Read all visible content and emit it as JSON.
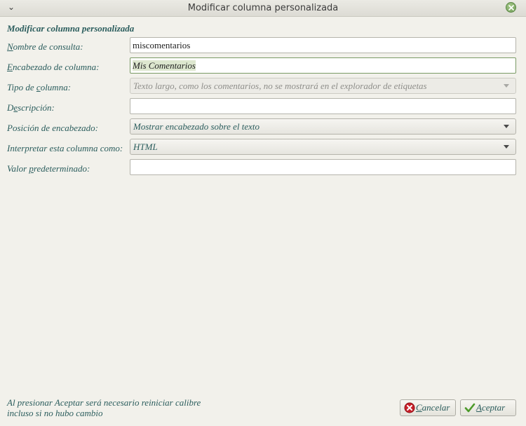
{
  "window": {
    "title": "Modificar columna personalizada",
    "menu_glyph": "⌄",
    "close_icon": "close-icon"
  },
  "form": {
    "section_title": "Modificar columna personalizada",
    "lookup_name": {
      "label_mnemonic": "N",
      "label_rest": "ombre de consulta:",
      "value": "miscomentarios"
    },
    "column_heading": {
      "label_mnemonic": "E",
      "label_rest": "ncabezado de columna:",
      "value": "Mis Comentarios"
    },
    "column_type": {
      "label_pre": "Tipo de ",
      "label_mnemonic": "c",
      "label_rest": "olumna:",
      "value": "Texto largo, como los comentarios, no se mostrará en el explorador de etiquetas",
      "disabled": true
    },
    "description": {
      "label_pre": "D",
      "label_mnemonic": "e",
      "label_rest": "scripción:",
      "value": ""
    },
    "heading_position": {
      "label": "Posición de encabezado:",
      "value": "Mostrar encabezado sobre el texto"
    },
    "interpret_as": {
      "label": "Interpretar esta columna como:",
      "value": "HTML"
    },
    "default_value": {
      "label_pre": "Valor ",
      "label_mnemonic": "p",
      "label_rest": "redeterminado:",
      "value": ""
    }
  },
  "footer": {
    "note_line1": "Al presionar Aceptar será necesario reiniciar calibre",
    "note_line2": "incluso si no hubo cambio",
    "cancel": {
      "mnemonic": "C",
      "rest": "ancelar",
      "icon": "cancel-icon"
    },
    "accept": {
      "mnemonic": "A",
      "rest": "ceptar",
      "icon": "checkmark-icon"
    }
  },
  "colors": {
    "label_text": "#2b5d5d",
    "window_bg": "#f2f1eb",
    "close_button": "#6f9d55",
    "cancel_icon": "#c8202a",
    "accept_icon": "#4c9a2a"
  }
}
